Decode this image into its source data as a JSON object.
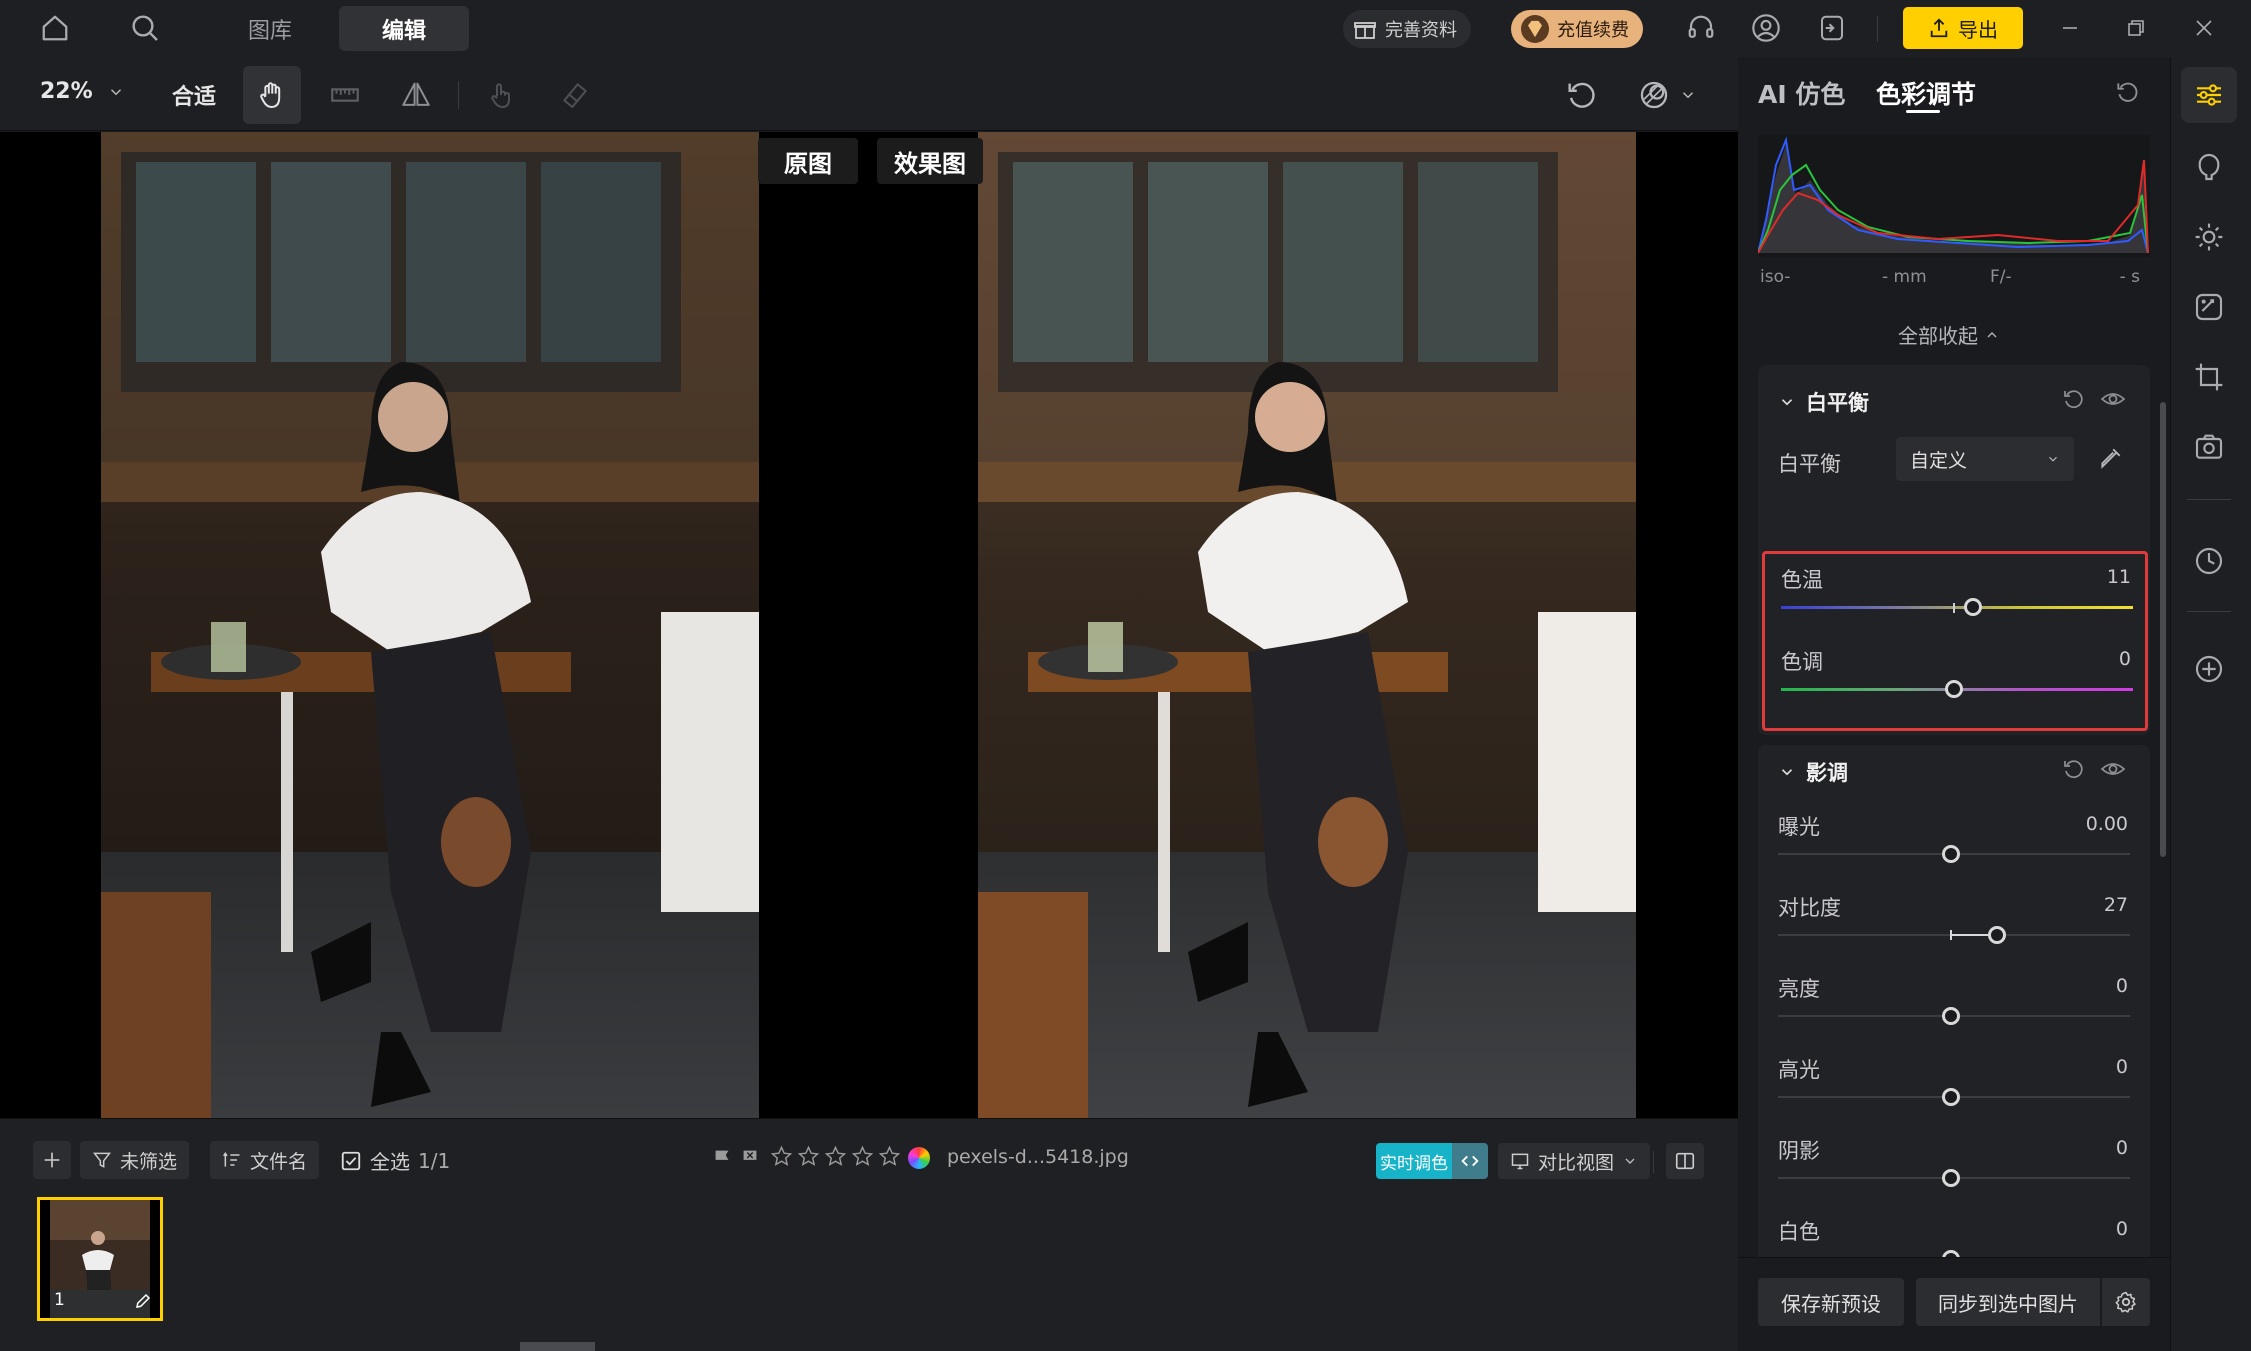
{
  "titlebar": {
    "tabs": [
      {
        "label": "图库"
      },
      {
        "label": "编辑"
      }
    ],
    "complete_profile": "完善资料",
    "recharge": "充值续费",
    "export": "导出"
  },
  "toolbar": {
    "zoom": "22%",
    "fit": "合适"
  },
  "canvas": {
    "original_label": "原图",
    "effect_label": "效果图"
  },
  "bottom": {
    "unfiltered": "未筛选",
    "filename_sort": "文件名",
    "select_all": "全选",
    "count": "1/1",
    "filename": "pexels-d...5418.jpg",
    "rating": 0,
    "realtime": "实时调色",
    "compare_view": "对比视图",
    "thumb_index": "1"
  },
  "panel": {
    "tabs": [
      {
        "label": "AI 仿色"
      },
      {
        "label": "色彩调节"
      }
    ],
    "exif": {
      "iso": "iso-",
      "mm": "- mm",
      "f": "F/-",
      "s": "- s"
    },
    "collapse_all": "全部收起",
    "white_balance": {
      "title": "白平衡",
      "row_label": "白平衡",
      "preset": "自定义",
      "sliders": [
        {
          "label": "色温",
          "value": "11"
        },
        {
          "label": "色调",
          "value": "0"
        }
      ]
    },
    "tone": {
      "title": "影调",
      "sliders": [
        {
          "label": "曝光",
          "value": "0.00"
        },
        {
          "label": "对比度",
          "value": "27"
        },
        {
          "label": "亮度",
          "value": "0"
        },
        {
          "label": "高光",
          "value": "0"
        },
        {
          "label": "阴影",
          "value": "0"
        },
        {
          "label": "白色",
          "value": "0"
        }
      ]
    },
    "save_preset": "保存新预设",
    "sync": "同步到选中图片"
  },
  "colors": {
    "accent_yellow": "#ffcf00",
    "highlight_red": "#e03a3a",
    "realtime_cyan": "#17b3c9"
  }
}
